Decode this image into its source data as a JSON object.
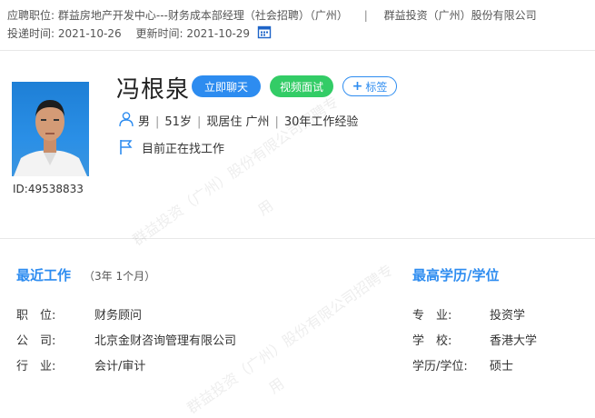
{
  "header": {
    "position_label": "应聘职位:",
    "position_value": "群益房地产开发中心---财务成本部经理（社会招聘）（广州）",
    "separator": "|",
    "company": "群益投资（广州）股份有限公司",
    "submitted_label": "投递时间:",
    "submitted_value": "2021-10-26",
    "updated_label": "更新时间:",
    "updated_value": "2021-10-29"
  },
  "candidate": {
    "name": "冯根泉",
    "id_text": "ID:49538833",
    "gender": "男",
    "age": "51岁",
    "residence": "现居住 广州",
    "experience": "30年工作经验",
    "status": "目前正在找工作",
    "info_separator": "|"
  },
  "actions": {
    "chat": "立即聊天",
    "video": "视频面试",
    "tag": "标签"
  },
  "recent_work": {
    "title": "最近工作",
    "duration": "（3年 1个月）",
    "rows": [
      {
        "label": "职　位:",
        "value": "财务顾问"
      },
      {
        "label": "公　司:",
        "value": "北京金财咨询管理有限公司"
      },
      {
        "label": "行　业:",
        "value": "会计/审计"
      }
    ]
  },
  "education": {
    "title": "最高学历/学位",
    "rows": [
      {
        "label": "专　业:",
        "value": "投资学"
      },
      {
        "label": "学　校:",
        "value": "香港大学"
      },
      {
        "label": "学历/学位:",
        "value": "硕士"
      }
    ]
  },
  "watermark": {
    "line1": "群益投资（广州）股份有限公司招聘专",
    "line2": "用"
  },
  "colors": {
    "accent": "#2d8cf0",
    "green": "#33cc66"
  }
}
